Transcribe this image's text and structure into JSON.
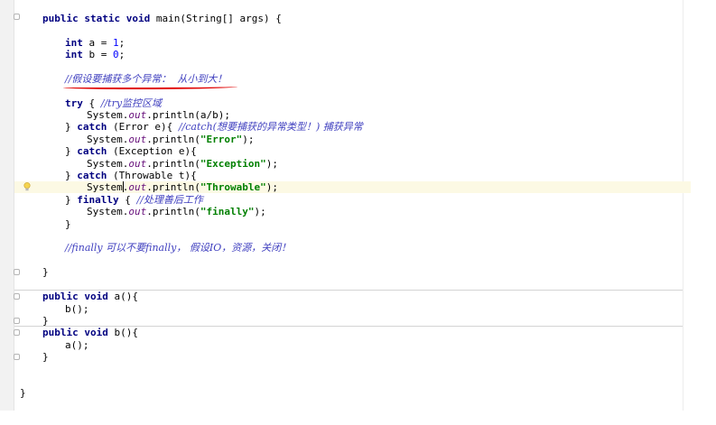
{
  "editor": {
    "main_sig": {
      "mod": "public static void",
      "rest": " main(String[] args) {"
    },
    "decl_a": {
      "kw": "int",
      "rest": " a = ",
      "num": "1",
      "end": ";"
    },
    "decl_b": {
      "kw": "int",
      "rest": " b = ",
      "num": "0",
      "end": ";"
    },
    "note_comment": "//假设要捕获多个异常：  从小到大！",
    "try_kw": "try",
    "try_open": " { ",
    "try_comment": "//try监控区域",
    "sys": "System.",
    "out": "out",
    "print_ab": ".println(a/b);",
    "close_brace": "} ",
    "catch_kw": "catch",
    "catch_error": " (Error e){ ",
    "catch_error_comment": "//catch(想要捕获的异常类型！) 捕获异常",
    "println_open": ".println(",
    "println_close": ");",
    "str_error": "\"Error\"",
    "catch_exception": " (Exception e){",
    "str_exception": "\"Exception\"",
    "catch_throwable": " (Throwable t){",
    "sys_a": "System",
    "sys_b": ".",
    "str_throwable": "\"Throwable\"",
    "finally_kw": "finally",
    "finally_open": " { ",
    "finally_comment": "//处理善后工作",
    "str_finally": "\"finally\"",
    "brace_close": "}",
    "finally_note": "//finally 可以不要finally， 假设IO，资源，关闭！",
    "method_kw": "public void",
    "a_sig": " a(){",
    "b_call": "b();",
    "b_sig": " b(){",
    "a_call": "a();"
  },
  "icons": {
    "intention": "lightbulb-icon",
    "fold": "fold-marker-icon"
  },
  "colors": {
    "keyword": "#000080",
    "number": "#0000ff",
    "string": "#008000",
    "field": "#660e7a",
    "comment": "#3f3fbf",
    "annotation_underline": "#e00000",
    "caret_row": "#fcf9e4"
  }
}
